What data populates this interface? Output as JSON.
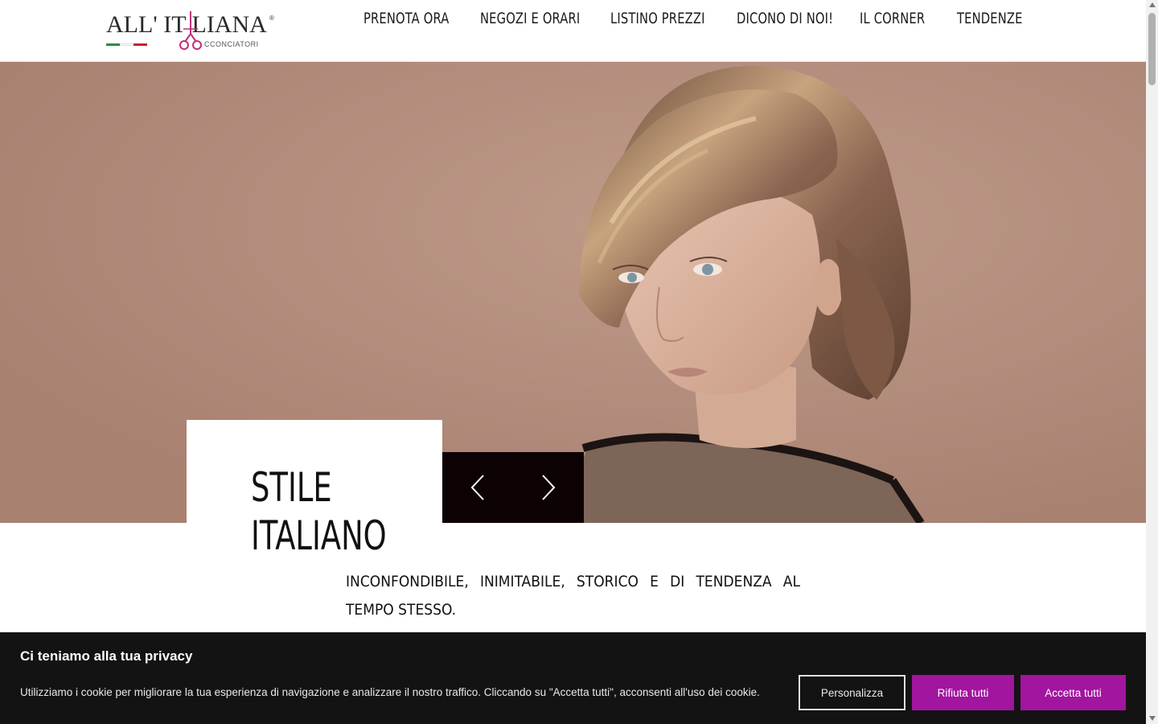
{
  "brand": {
    "name": "ALL' IT LIANA",
    "registered": "®",
    "subtitle": "CCONCIATORI",
    "flag_colors": [
      "#2e8b3a",
      "#ffffff",
      "#c8202e"
    ],
    "accent": "#c0307a"
  },
  "nav": {
    "items": [
      {
        "label": "PRENOTA ORA"
      },
      {
        "label": "NEGOZI E ORARI"
      },
      {
        "label": "LISTINO PREZZI"
      },
      {
        "label": "DICONO DI NOI!"
      },
      {
        "label": "IL CORNER"
      },
      {
        "label": "TENDENZE"
      }
    ]
  },
  "hero": {
    "caption_line1": "STILE",
    "caption_line2": "ITALIANO",
    "prev_icon": "chevron-left-icon",
    "next_icon": "chevron-right-icon"
  },
  "intro": {
    "text": "INCONFONDIBILE, INIMITABILE, STORICO E DI TENDENZA AL TEMPO STESSO."
  },
  "cookie": {
    "title": "Ci teniamo alla tua privacy",
    "text": "Utilizziamo i cookie per migliorare la tua esperienza di navigazione e analizzare il nostro traffico. Cliccando su \"Accetta tutti\", acconsenti all'uso dei cookie.",
    "customize_label": "Personalizza",
    "reject_label": "Rifiuta tutti",
    "accept_label": "Accetta tutti",
    "button_color": "#a1159f"
  }
}
